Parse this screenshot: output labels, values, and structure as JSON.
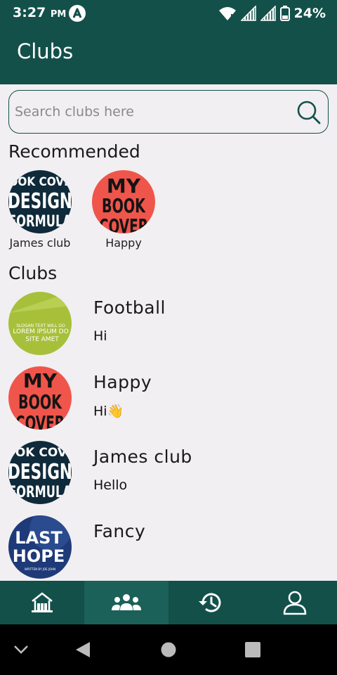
{
  "status_bar": {
    "time": "3:27",
    "ampm": "PM",
    "battery": "24%",
    "icons": [
      "app-notification-icon",
      "wifi-icon",
      "signal-icon",
      "signal-icon",
      "battery-icon"
    ]
  },
  "app_bar": {
    "title": "Clubs"
  },
  "search": {
    "placeholder": "Search clubs here",
    "icon": "search-icon"
  },
  "recommended": {
    "title": "Recommended",
    "items": [
      {
        "label": "James club",
        "cover": "design-formula"
      },
      {
        "label": "Happy",
        "cover": "my-book-cover"
      }
    ]
  },
  "clubs": {
    "title": "Clubs",
    "items": [
      {
        "name": "Football",
        "message": "Hi",
        "cover": "slogan-lorem"
      },
      {
        "name": "Happy",
        "message": "Hi👋",
        "cover": "my-book-cover"
      },
      {
        "name": "James club",
        "message": "Hello",
        "cover": "design-formula"
      },
      {
        "name": "Fancy",
        "message": "",
        "cover": "last-hope"
      }
    ]
  },
  "covers": {
    "design_formula": {
      "lines": [
        "OOK COVE",
        "DESIGN",
        "FORMULA"
      ]
    },
    "my_book_cover": {
      "lines": [
        "MY",
        "BOOK",
        "COVER"
      ]
    },
    "slogan_lorem": {
      "lines": [
        "SLOGAN TEXT WILL GO",
        "LOREM IPSUM DO",
        "SITE AMET"
      ],
      "highlight": "IPSUM"
    },
    "last_hope": {
      "lines": [
        "LAST",
        "HOPE",
        "WRITTEN BY JOE JOHN"
      ]
    }
  },
  "bottom_nav": {
    "items": [
      {
        "icon": "home-icon",
        "active": false
      },
      {
        "icon": "group-icon",
        "active": true
      },
      {
        "icon": "history-icon",
        "active": false
      },
      {
        "icon": "profile-icon",
        "active": false
      }
    ]
  },
  "system_nav": {
    "icons": [
      "chevron-down-icon",
      "back-icon",
      "home-circle-icon",
      "recents-icon"
    ]
  },
  "colors": {
    "primary": "#13504a",
    "primary_active": "#1b6059",
    "background": "#f1eff1",
    "cover_red": "#f0554b",
    "cover_navy": "#0f2a3a",
    "cover_lime": "#a6c03a",
    "cover_blue": "#1e3a78"
  }
}
